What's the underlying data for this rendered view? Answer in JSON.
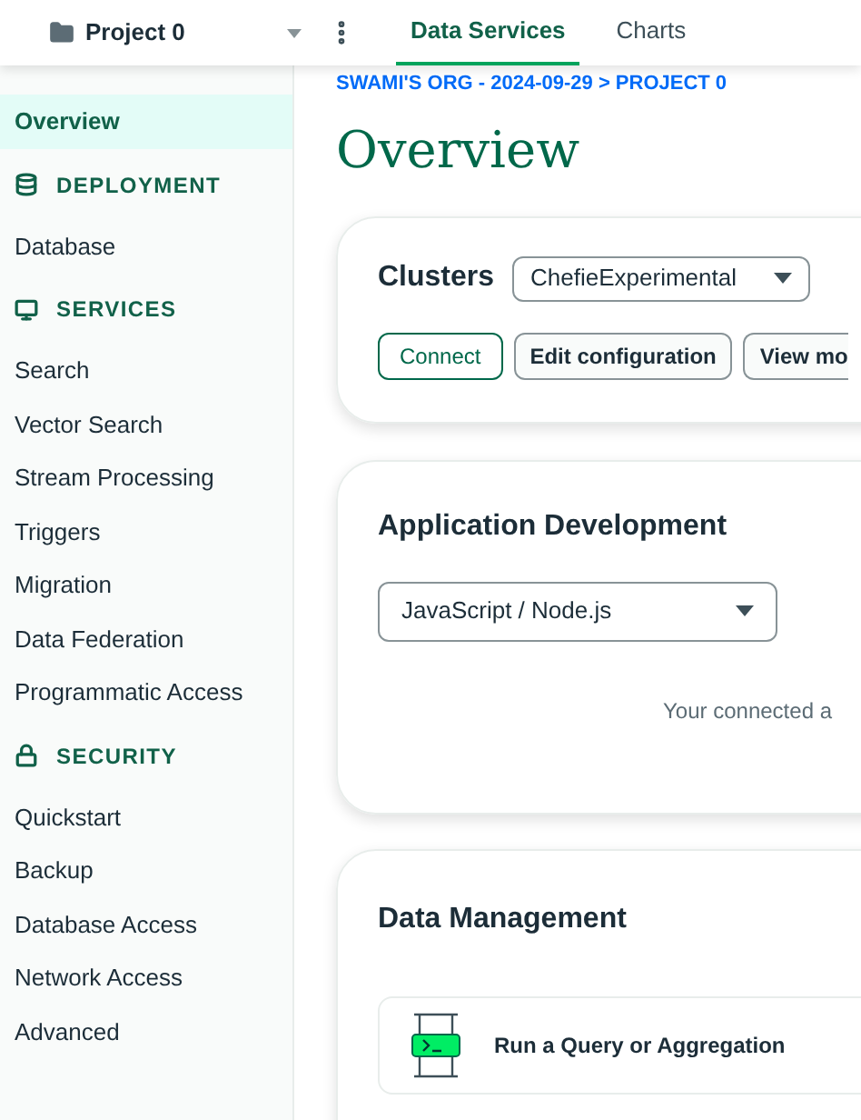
{
  "project": {
    "name": "Project 0"
  },
  "tabs": [
    {
      "label": "Data Services",
      "selected": true
    },
    {
      "label": "Charts",
      "selected": false
    }
  ],
  "sidebar": {
    "items": [
      {
        "kind": "link",
        "label": "Overview",
        "selected": true
      },
      {
        "kind": "heading",
        "label": "DEPLOYMENT"
      },
      {
        "kind": "link",
        "label": "Database",
        "selected": false
      },
      {
        "kind": "heading",
        "label": "SERVICES"
      },
      {
        "kind": "link",
        "label": "Search",
        "selected": false
      },
      {
        "kind": "link",
        "label": "Vector Search",
        "selected": false
      },
      {
        "kind": "link",
        "label": "Stream Processing",
        "selected": false
      },
      {
        "kind": "link",
        "label": "Triggers",
        "selected": false
      },
      {
        "kind": "link",
        "label": "Migration",
        "selected": false
      },
      {
        "kind": "link",
        "label": "Data Federation",
        "selected": false
      },
      {
        "kind": "link",
        "label": "Programmatic Access",
        "selected": false
      },
      {
        "kind": "heading",
        "label": "SECURITY"
      },
      {
        "kind": "link",
        "label": "Quickstart",
        "selected": false
      },
      {
        "kind": "link",
        "label": "Backup",
        "selected": false
      },
      {
        "kind": "link",
        "label": "Database Access",
        "selected": false
      },
      {
        "kind": "link",
        "label": "Network Access",
        "selected": false
      },
      {
        "kind": "link",
        "label": "Advanced",
        "selected": false
      }
    ]
  },
  "breadcrumb": "SWAMI'S ORG - 2024-09-29 > PROJECT 0",
  "page_title": "Overview",
  "clusters": {
    "title": "Clusters",
    "selected_cluster": "ChefieExperimental",
    "buttons": [
      {
        "label": "Connect",
        "kind": "primary"
      },
      {
        "label": "Edit configuration",
        "kind": "default"
      },
      {
        "label": "View mo",
        "kind": "cut"
      }
    ]
  },
  "app_development": {
    "title": "Application Development",
    "language": "JavaScript / Node.js",
    "note": "Your connected a"
  },
  "data_management": {
    "title": "Data Management",
    "action": "Run a Query or Aggregation"
  }
}
